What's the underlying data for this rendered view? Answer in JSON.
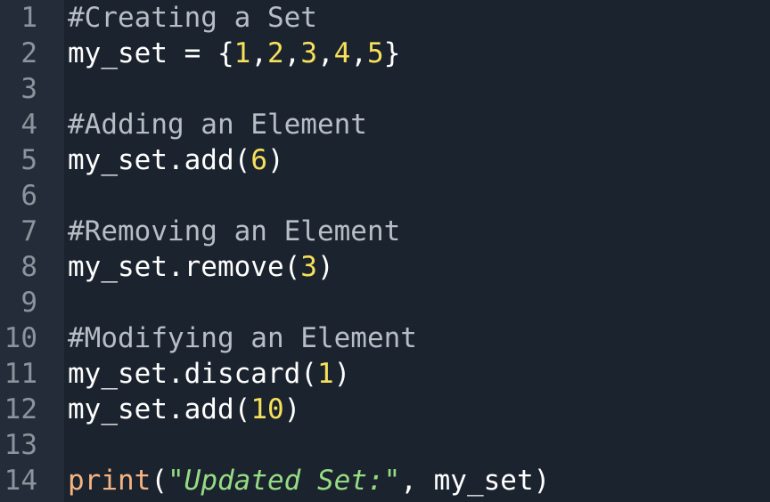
{
  "editor": {
    "colors": {
      "background": "#1b232e",
      "gutter": "#232c38",
      "line_number": "#8b939c",
      "comment": "#b6bdc5",
      "number": "#f7e05a",
      "builtin": "#f5b382",
      "string": "#96db84",
      "text": "#ffffff"
    },
    "lines": [
      {
        "number": "1",
        "tokens": [
          {
            "type": "comment",
            "text": "#Creating a Set"
          }
        ]
      },
      {
        "number": "2",
        "tokens": [
          {
            "type": "plain",
            "text": "my_set = {"
          },
          {
            "type": "num",
            "text": "1"
          },
          {
            "type": "plain",
            "text": ","
          },
          {
            "type": "num",
            "text": "2"
          },
          {
            "type": "plain",
            "text": ","
          },
          {
            "type": "num",
            "text": "3"
          },
          {
            "type": "plain",
            "text": ","
          },
          {
            "type": "num",
            "text": "4"
          },
          {
            "type": "plain",
            "text": ","
          },
          {
            "type": "num",
            "text": "5"
          },
          {
            "type": "plain",
            "text": "}"
          }
        ]
      },
      {
        "number": "3",
        "tokens": []
      },
      {
        "number": "4",
        "tokens": [
          {
            "type": "comment",
            "text": "#Adding an Element"
          }
        ]
      },
      {
        "number": "5",
        "tokens": [
          {
            "type": "plain",
            "text": "my_set.add("
          },
          {
            "type": "num",
            "text": "6"
          },
          {
            "type": "plain",
            "text": ")"
          }
        ]
      },
      {
        "number": "6",
        "tokens": []
      },
      {
        "number": "7",
        "tokens": [
          {
            "type": "comment",
            "text": "#Removing an Element"
          }
        ]
      },
      {
        "number": "8",
        "tokens": [
          {
            "type": "plain",
            "text": "my_set.remove("
          },
          {
            "type": "num",
            "text": "3"
          },
          {
            "type": "plain",
            "text": ")"
          }
        ]
      },
      {
        "number": "9",
        "tokens": []
      },
      {
        "number": "10",
        "tokens": [
          {
            "type": "comment",
            "text": "#Modifying an Element"
          }
        ]
      },
      {
        "number": "11",
        "tokens": [
          {
            "type": "plain",
            "text": "my_set.discard("
          },
          {
            "type": "num",
            "text": "1"
          },
          {
            "type": "plain",
            "text": ")"
          }
        ]
      },
      {
        "number": "12",
        "tokens": [
          {
            "type": "plain",
            "text": "my_set.add("
          },
          {
            "type": "num",
            "text": "10"
          },
          {
            "type": "plain",
            "text": ")"
          }
        ]
      },
      {
        "number": "13",
        "tokens": []
      },
      {
        "number": "14",
        "tokens": [
          {
            "type": "builtin",
            "text": "print"
          },
          {
            "type": "plain",
            "text": "("
          },
          {
            "type": "string",
            "text": "\"Updated Set:\""
          },
          {
            "type": "plain",
            "text": ", my_set)"
          }
        ]
      }
    ]
  }
}
